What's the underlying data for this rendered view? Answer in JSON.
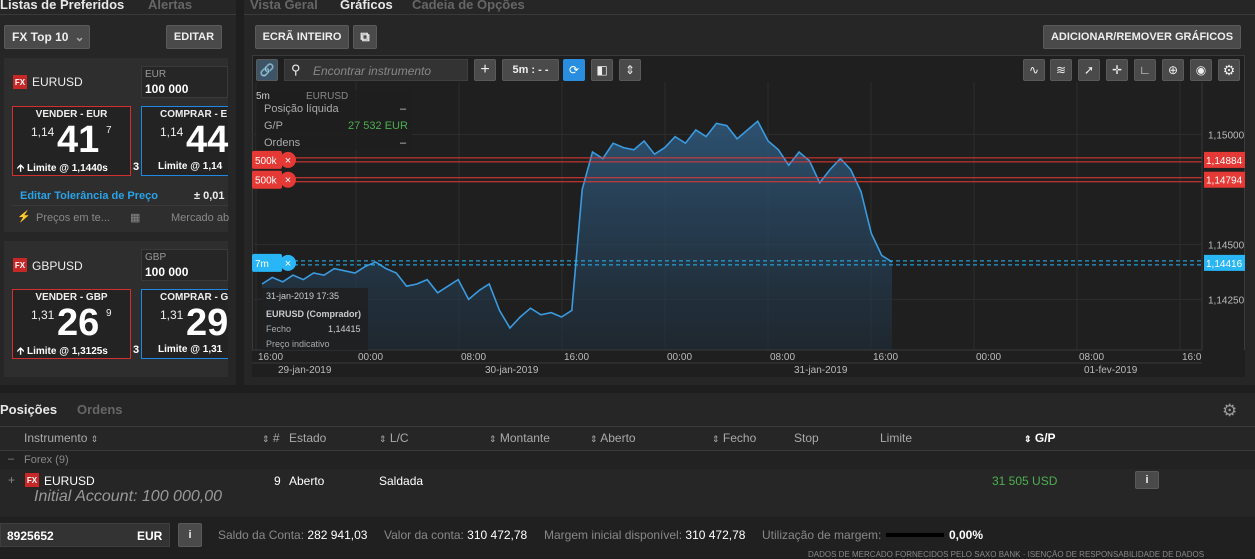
{
  "watchlist": {
    "tabs": [
      "Listas de Preferidos",
      "Alertas"
    ],
    "selector": "FX Top 10",
    "edit_label": "EDITAR",
    "instruments": [
      {
        "name": "EURUSD",
        "badge": "FX",
        "currency": "EUR",
        "amount": "100 000",
        "sell_label": "VENDER - EUR",
        "buy_label": "COMPRAR - E",
        "sell_pre": "1,14",
        "sell_big": "41",
        "sell_sup": "7",
        "buy_pre": "1,14",
        "buy_big": "44",
        "spread": "3",
        "sell_limit": "Limite @ 1,1440s",
        "buy_limit": "Limite @ 1,14",
        "tolerance_label": "Editar Tolerância de Preço",
        "tolerance_value": "± 0,01",
        "prices_label": "Preços em te...",
        "market_label": "Mercado ab"
      },
      {
        "name": "GBPUSD",
        "badge": "FX",
        "currency": "GBP",
        "amount": "100 000",
        "sell_label": "VENDER - GBP",
        "buy_label": "COMPRAR - G",
        "sell_pre": "1,31",
        "sell_big": "26",
        "sell_sup": "9",
        "buy_pre": "1,31",
        "buy_big": "29",
        "spread": "3",
        "sell_limit": "Limite @ 1,3125s",
        "buy_limit": "Limite @ 1,31"
      }
    ]
  },
  "chart_panel": {
    "tabs": [
      "Vista Geral",
      "Gráficos",
      "Cadeia de Opções"
    ],
    "fullscreen_label": "ECRÃ INTEIRO",
    "add_remove_label": "ADICIONAR/REMOVER GRÁFICOS",
    "search_placeholder": "Encontrar instrumento",
    "interval_label": "5m : - -",
    "info": {
      "instrument": "EURUSD",
      "interval": "5m",
      "net_position_label": "Posição líquida",
      "net_position_value": "–",
      "pl_label": "G/P",
      "pl_value": "27 532 EUR",
      "orders_label": "Ordens",
      "orders_value": "–"
    },
    "order_lines": [
      {
        "label": "500k",
        "price": "1,14884",
        "color": "#e53935"
      },
      {
        "label": "500k",
        "price": "1,14794",
        "color": "#e53935"
      },
      {
        "label": "7m",
        "price": "1,14416",
        "color": "#29b6f6"
      }
    ],
    "tooltip": {
      "date": "31-jan-2019 17:35",
      "instrument": "EURUSD (Comprador)",
      "close_label": "Fecho",
      "close_value": "1,14415",
      "indicative": "Preço indicativo"
    }
  },
  "chart_data": {
    "type": "area",
    "instrument": "EURUSD",
    "y_ticks": [
      1.15,
      1.145,
      1.1425
    ],
    "y_tick_labels": [
      "1,15000",
      "1,14500",
      "1,14250"
    ],
    "ylim": [
      1.1402,
      1.1522
    ],
    "x_time_labels": [
      "16:00",
      "00:00",
      "08:00",
      "16:00",
      "00:00",
      "08:00",
      "16:00",
      "00:00",
      "08:00",
      "16:0"
    ],
    "x_date_labels": [
      "29-jan-2019",
      "30-jan-2019",
      "31-jan-2019",
      "01-fev-2019"
    ],
    "series": [
      {
        "values": [
          1.1432,
          1.1435,
          1.1433,
          1.1436,
          1.1434,
          1.1437,
          1.1436,
          1.1439,
          1.1438,
          1.1437,
          1.144,
          1.1442,
          1.1439,
          1.1437,
          1.1431,
          1.1432,
          1.1434,
          1.1428,
          1.1431,
          1.1434,
          1.1425,
          1.1429,
          1.1432,
          1.142,
          1.1412,
          1.1417,
          1.1421,
          1.1418,
          1.1419,
          1.1417,
          1.142,
          1.1475,
          1.1492,
          1.1489,
          1.1496,
          1.1494,
          1.1493,
          1.1497,
          1.1491,
          1.1494,
          1.1499,
          1.1496,
          1.1502,
          1.1499,
          1.1505,
          1.1504,
          1.1498,
          1.1502,
          1.1506,
          1.1497,
          1.1493,
          1.1486,
          1.1492,
          1.1488,
          1.1478,
          1.1484,
          1.1489,
          1.1484,
          1.1474,
          1.1455,
          1.1445,
          1.1442
        ]
      }
    ]
  },
  "positions": {
    "tabs": [
      "Posições",
      "Ordens"
    ],
    "columns": [
      "Instrumento",
      "#",
      "Estado",
      "L/C",
      "Montante",
      "Aberto",
      "Fecho",
      "Stop",
      "Limite",
      "G/P"
    ],
    "group": "Forex (9)",
    "rows": [
      {
        "instrument": "EURUSD",
        "badge": "FX",
        "count": "9",
        "status": "Aberto",
        "lc": "Saldada",
        "pl": "31 505 USD"
      }
    ],
    "initial_account": "Initial Account: 100 000,00"
  },
  "footer": {
    "account_id": "8925652",
    "currency": "EUR",
    "balance_label": "Saldo da Conta:",
    "balance_value": "282 941,03",
    "value_label": "Valor da conta:",
    "value_value": "310 472,78",
    "margin_label": "Margem inicial disponível:",
    "margin_value": "310 472,78",
    "utilization_label": "Utilização de margem:",
    "utilization_value": "0,00%",
    "utilization_fraction": 0,
    "disclaimer": "DADOS DE MERCADO FORNECIDOS PELO SAXO BANK · ISENÇÃO DE RESPONSABILIDADE DE DADOS"
  },
  "colors": {
    "sell": "#d32f2f",
    "buy": "#1e88e5",
    "line": "#3a9be0",
    "profit": "#4caf50"
  }
}
